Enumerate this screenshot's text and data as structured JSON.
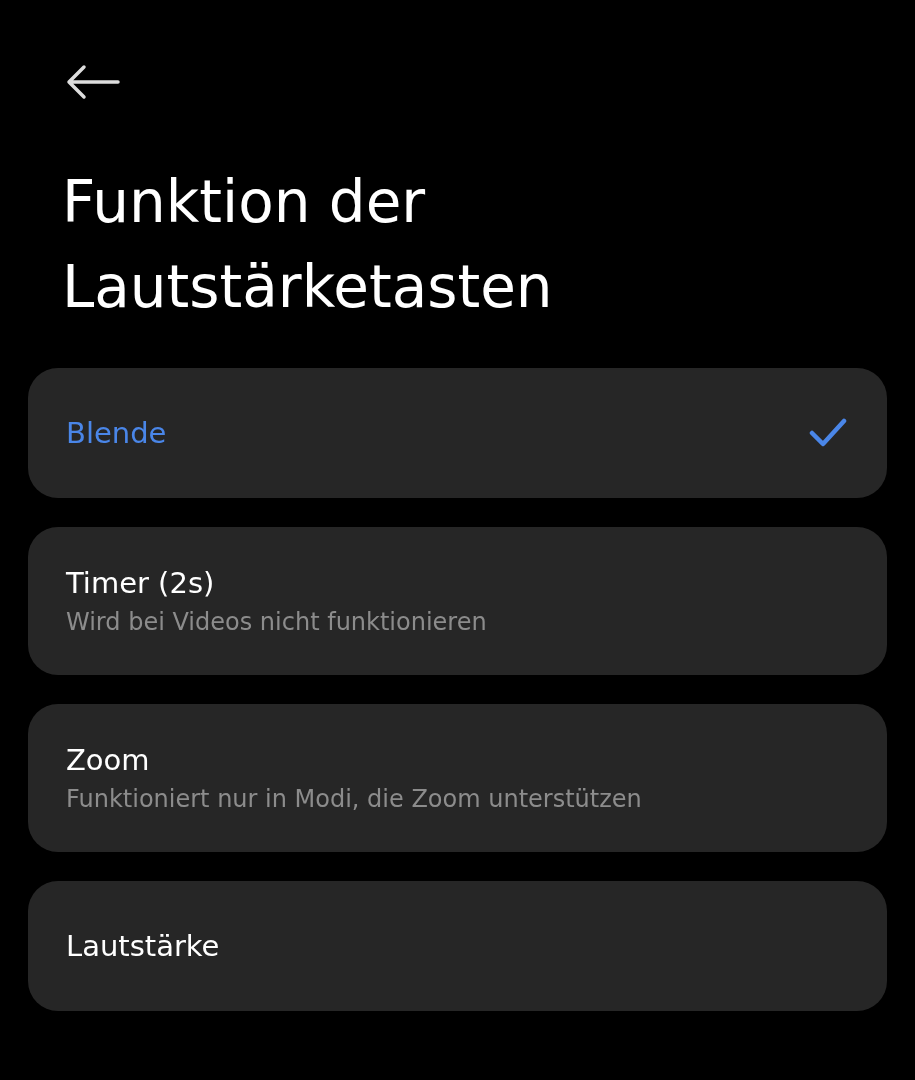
{
  "title": "Funktion der Lautstärketasten",
  "options": [
    {
      "label": "Blende",
      "selected": true
    },
    {
      "label": "Timer (2s)",
      "description": "Wird bei Videos nicht funktionieren",
      "selected": false
    },
    {
      "label": "Zoom",
      "description": "Funktioniert nur in Modi, die Zoom unterstützen",
      "selected": false
    },
    {
      "label": "Lautstärke",
      "selected": false
    }
  ]
}
